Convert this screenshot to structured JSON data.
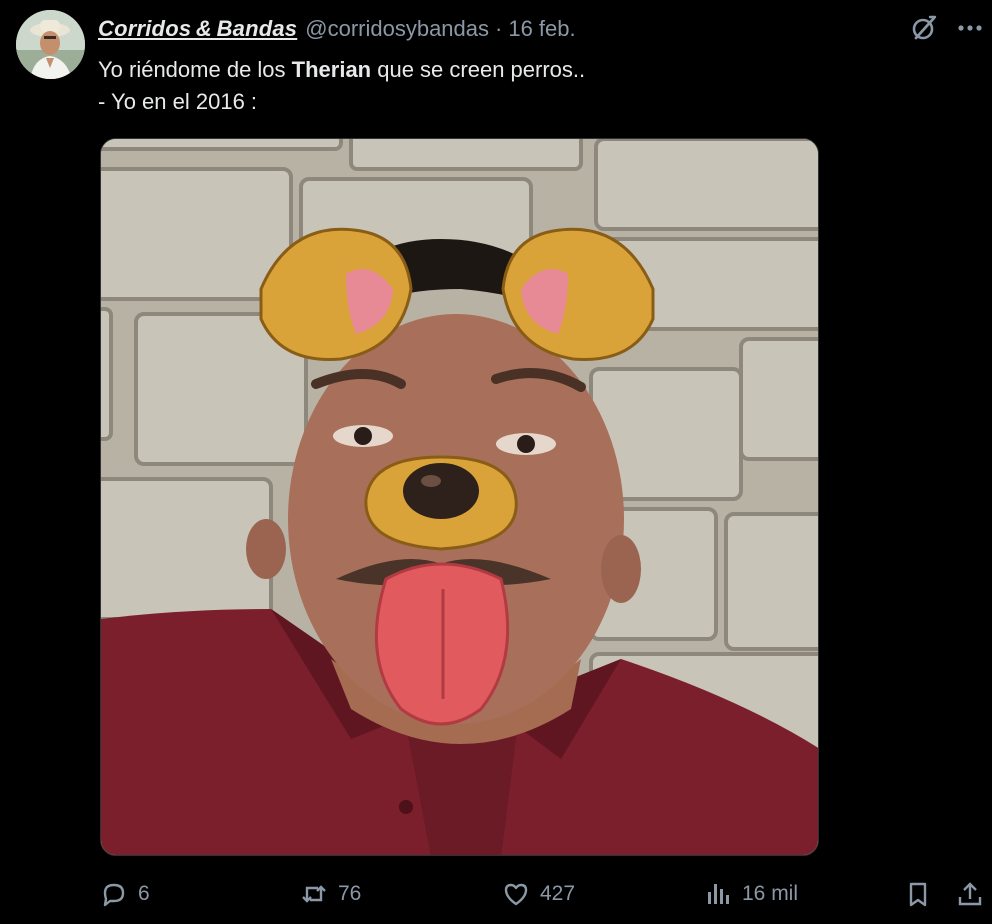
{
  "author": {
    "display_name": "Corridos & Bandas",
    "handle": "@corridosybandas",
    "separator": "·",
    "date": "16 feb."
  },
  "tweet": {
    "line1_before": "Yo riéndome de los ",
    "line1_bold": "Therian",
    "line1_after": " que se creen perros..",
    "line2": "- Yo en el 2016 :"
  },
  "actions": {
    "replies": "6",
    "retweets": "76",
    "likes": "427",
    "views": "16 mil"
  },
  "icons": {
    "grok": "grok-slash-icon",
    "more": "more-horizontal-icon",
    "reply": "speech-bubble-icon",
    "retweet": "retweet-arrows-icon",
    "like": "heart-icon",
    "views": "bar-chart-icon",
    "bookmark": "bookmark-icon",
    "share": "share-upload-icon"
  },
  "colors": {
    "background": "#000000",
    "text": "#e7e9ea",
    "muted": "#8b98a5",
    "shirt": "#7a1f2b",
    "dog_ear": "#d9a33a",
    "tongue": "#e05a5e"
  }
}
